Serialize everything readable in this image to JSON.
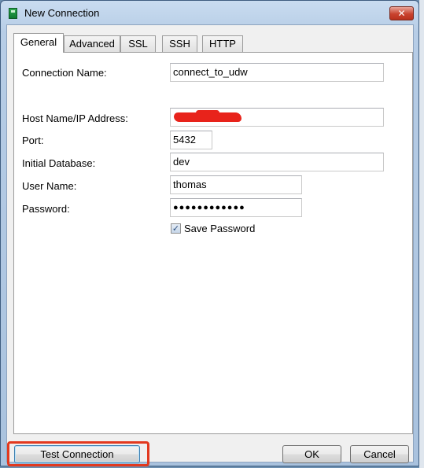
{
  "window": {
    "title": "New Connection",
    "close_glyph": "✕",
    "icon": "app-db-icon"
  },
  "tabs": [
    {
      "label": "General",
      "active": true
    },
    {
      "label": "Advanced",
      "active": false
    },
    {
      "label": "SSL",
      "active": false
    },
    {
      "label": "SSH",
      "active": false
    },
    {
      "label": "HTTP",
      "active": false
    }
  ],
  "form": {
    "connection_name": {
      "label": "Connection Name:",
      "value": "connect_to_udw"
    },
    "host": {
      "label": "Host Name/IP Address:",
      "value": ""
    },
    "port": {
      "label": "Port:",
      "value": "5432"
    },
    "initial_db": {
      "label": "Initial Database:",
      "value": "dev"
    },
    "user": {
      "label": "User Name:",
      "value": "thomas"
    },
    "password": {
      "label": "Password:",
      "masked": "●●●●●●●●●●●●"
    },
    "save_password": {
      "label": "Save Password",
      "checked": true,
      "glyph": "✓"
    }
  },
  "buttons": {
    "test_connection": "Test Connection",
    "ok": "OK",
    "cancel": "Cancel"
  },
  "colors": {
    "highlight": "#e2391f",
    "redaction": "#e8231b"
  }
}
